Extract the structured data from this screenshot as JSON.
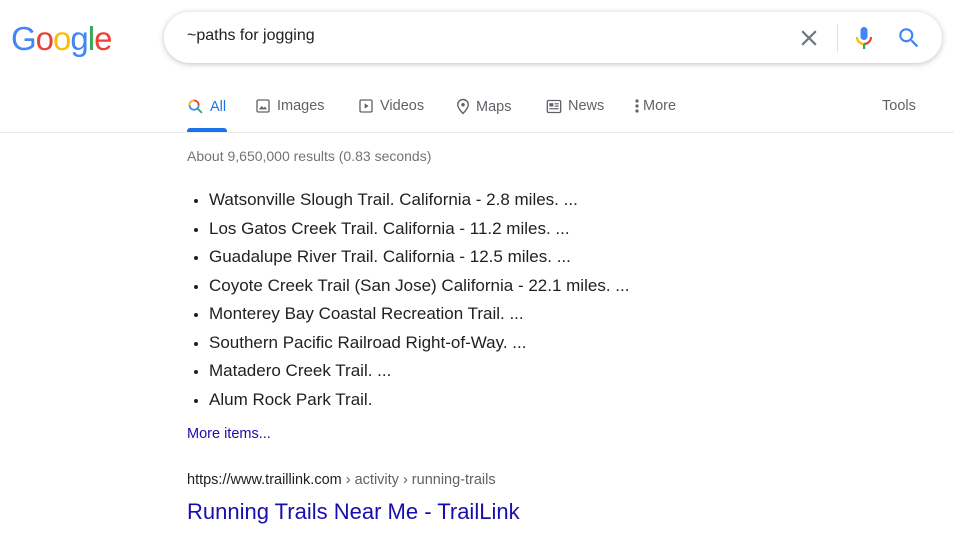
{
  "logo": {
    "letters": [
      {
        "char": "G",
        "color": "#4285F4"
      },
      {
        "char": "o",
        "color": "#EA4335"
      },
      {
        "char": "o",
        "color": "#FBBC05"
      },
      {
        "char": "g",
        "color": "#4285F4"
      },
      {
        "char": "l",
        "color": "#34A853"
      },
      {
        "char": "e",
        "color": "#EA4335"
      }
    ]
  },
  "search": {
    "query": "~paths for jogging",
    "clear_icon": "close-icon",
    "mic_icon": "microphone-icon",
    "search_icon": "search-icon"
  },
  "tabs": [
    {
      "label": "All",
      "icon": "search-icon",
      "active": true
    },
    {
      "label": "Images",
      "icon": "image-icon"
    },
    {
      "label": "Videos",
      "icon": "play-icon"
    },
    {
      "label": "Maps",
      "icon": "map-pin-icon"
    },
    {
      "label": "News",
      "icon": "newspaper-icon"
    },
    {
      "label": "More",
      "icon": "more-vert-icon"
    }
  ],
  "tools_label": "Tools",
  "result_stats": "About 9,650,000 results (0.83 seconds)",
  "featured_list": [
    "Watsonville Slough Trail. California - 2.8 miles. ...",
    "Los Gatos Creek Trail. California - 11.2 miles. ...",
    "Guadalupe River Trail. California - 12.5 miles. ...",
    "Coyote Creek Trail (San Jose) California - 22.1 miles. ...",
    "Monterey Bay Coastal Recreation Trail. ...",
    "Southern Pacific Railroad Right-of-Way. ...",
    "Matadero Creek Trail. ...",
    "Alum Rock Park Trail."
  ],
  "more_items_label": "More items...",
  "result": {
    "cite_domain": "https://www.traillink.com",
    "cite_path": " › activity › running-trails",
    "title": "Running Trails Near Me - TrailLink"
  },
  "colors": {
    "accent": "#1a73e8",
    "link": "#1a0dab",
    "secondary_text": "#70757a"
  }
}
